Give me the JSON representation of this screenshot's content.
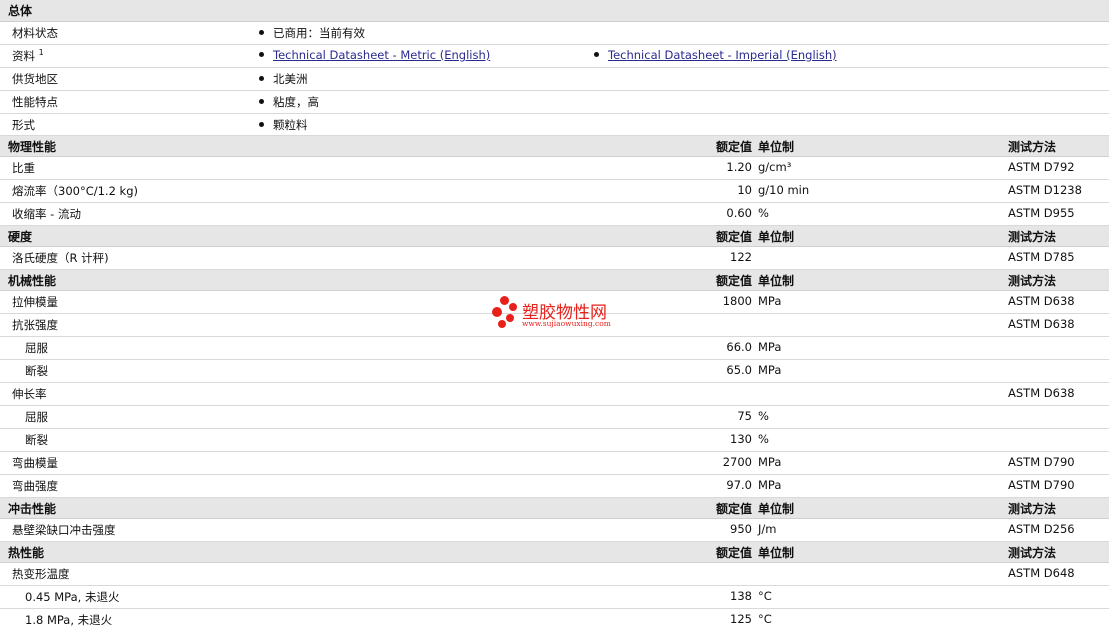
{
  "general": {
    "title": "总体",
    "rows": [
      {
        "label": "材料状态",
        "items": [
          "已商用：当前有效"
        ]
      },
      {
        "label": "资料",
        "footnote": "1",
        "links": [
          "Technical Datasheet - Metric (English)",
          "Technical Datasheet - Imperial (English)"
        ]
      },
      {
        "label": "供货地区",
        "items": [
          "北美洲"
        ]
      },
      {
        "label": "性能特点",
        "items": [
          "粘度，高"
        ]
      },
      {
        "label": "形式",
        "items": [
          "颗粒料"
        ]
      }
    ]
  },
  "headers": {
    "value": "额定值",
    "unit": "单位制",
    "test": "测试方法"
  },
  "sections": [
    {
      "title": "物理性能",
      "rows": [
        {
          "prop": "比重",
          "value": "1.20",
          "unit": "g/cm³",
          "test": "ASTM D792"
        },
        {
          "prop": "熔流率（300°C/1.2 kg)",
          "value": "10",
          "unit": "g/10 min",
          "test": "ASTM D1238"
        },
        {
          "prop": "收缩率 - 流动",
          "value": "0.60",
          "unit": "%",
          "test": "ASTM D955"
        }
      ]
    },
    {
      "title": "硬度",
      "rows": [
        {
          "prop": "洛氏硬度（R 计秤)",
          "value": "122",
          "unit": "",
          "test": "ASTM D785"
        }
      ]
    },
    {
      "title": "机械性能",
      "rows": [
        {
          "prop": "拉伸模量",
          "value": "1800",
          "unit": "MPa",
          "test": "ASTM D638"
        },
        {
          "prop": "抗张强度",
          "value": "",
          "unit": "",
          "test": "ASTM D638"
        },
        {
          "prop": "屈服",
          "indent": true,
          "value": "66.0",
          "unit": "MPa",
          "test": ""
        },
        {
          "prop": "断裂",
          "indent": true,
          "value": "65.0",
          "unit": "MPa",
          "test": ""
        },
        {
          "prop": "伸长率",
          "value": "",
          "unit": "",
          "test": "ASTM D638"
        },
        {
          "prop": "屈服",
          "indent": true,
          "value": "75",
          "unit": "%",
          "test": ""
        },
        {
          "prop": "断裂",
          "indent": true,
          "value": "130",
          "unit": "%",
          "test": ""
        },
        {
          "prop": "弯曲模量",
          "value": "2700",
          "unit": "MPa",
          "test": "ASTM D790"
        },
        {
          "prop": "弯曲强度",
          "value": "97.0",
          "unit": "MPa",
          "test": "ASTM D790"
        }
      ]
    },
    {
      "title": "冲击性能",
      "rows": [
        {
          "prop": "悬壁梁缺口冲击强度",
          "value": "950",
          "unit": "J/m",
          "test": "ASTM D256"
        }
      ]
    },
    {
      "title": "热性能",
      "rows": [
        {
          "prop": "热变形温度",
          "value": "",
          "unit": "",
          "test": "ASTM D648"
        },
        {
          "prop": "0.45 MPa, 未退火",
          "indent": true,
          "value": "138",
          "unit": "°C",
          "test": ""
        },
        {
          "prop": "1.8 MPa, 未退火",
          "indent": true,
          "value": "125",
          "unit": "°C",
          "test": ""
        }
      ]
    }
  ],
  "watermark": {
    "name": "塑胶物性网",
    "url": "www.sujiaowuxing.com",
    "color": "#e8201a"
  }
}
